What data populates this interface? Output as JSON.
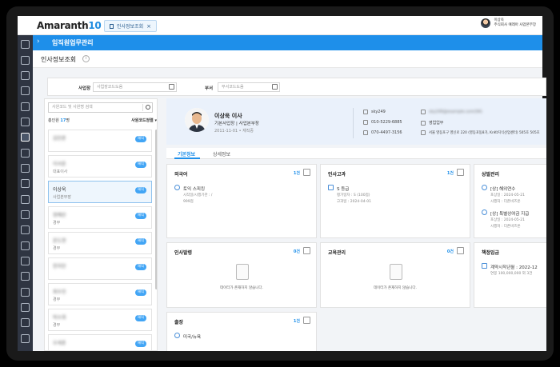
{
  "app": {
    "logo_main": "Amaranth",
    "logo_num": "10"
  },
  "open_tab": {
    "label": "인사정보조회",
    "close": "×"
  },
  "user": {
    "name": "이상욱",
    "org": "주식회사 예레아 사업본부장"
  },
  "menu": {
    "title": "임직원업무관리",
    "chevron": "›"
  },
  "page": {
    "title": "인사정보조회",
    "info": "i"
  },
  "filters": {
    "site_label": "사업장",
    "site_placeholder": "사업장코드도움",
    "dept_label": "부서",
    "dept_placeholder": "부서코드도움"
  },
  "employee_list": {
    "search_placeholder": "사원코드 및 사원명 검색",
    "count_prefix": "총인원 ",
    "count": "17",
    "count_suffix": "명",
    "sort_label": "사원코드정렬 ▾",
    "items": [
      {
        "name": "김민준",
        "role": "",
        "badge": "재직",
        "blur": true
      },
      {
        "name": "이서윤",
        "role": "대표이사",
        "badge": "재직",
        "blur": true
      },
      {
        "name": "이상욱",
        "role": "사업본부장",
        "badge": "재직",
        "blur": false
      },
      {
        "name": "정예린",
        "role": "경부",
        "badge": "재직",
        "blur": true
      },
      {
        "name": "윤도현",
        "role": "경부",
        "badge": "재직",
        "blur": true
      },
      {
        "name": "한지민",
        "role": "",
        "badge": "재직",
        "blur": true
      },
      {
        "name": "최우진",
        "role": "경부",
        "badge": "재직",
        "blur": true
      },
      {
        "name": "박소희",
        "role": "경부",
        "badge": "재직",
        "blur": true
      },
      {
        "name": "오세훈",
        "role": "",
        "badge": "재직",
        "blur": true
      }
    ]
  },
  "profile": {
    "name": "이상욱 이사",
    "dept": "기본사업장 | 사업본부장",
    "date": "2011-11-01 • 재직중",
    "id": "sky249",
    "phone": "010-5229-6885",
    "tel": "070-4497-3156",
    "email": "sky249@example.com(94)",
    "job": "영업업무",
    "address": "서울 영등포구 영신로 220 (영등포동8가, KnKt지식산업센터) 505호 505호"
  },
  "tabs": {
    "basic": "기본정보",
    "detail": "상세정보"
  },
  "cards": {
    "lang": {
      "title": "외국어",
      "count": "1건",
      "item": "토익 스피킹",
      "sub1": "시작일/시행기관 : /",
      "sub2": "999점"
    },
    "cert": {
      "title": "인사고과",
      "count": "1건",
      "item": "S 등급",
      "sub1": "평가일자 : S (100점)",
      "sub2": "고과일 : 2024-04-01"
    },
    "award": {
      "title": "상벌관리",
      "item1": "[상] 해외연수",
      "sub1a": "포상일 : 2024-05-21",
      "sub1b": "시행처 : 더존비즈온",
      "item2": "[상] 특별상여금 지급",
      "sub2a": "포상일 : 2024-05-21",
      "sub2b": "시행처 : 더존비즈온"
    },
    "appoint": {
      "title": "인사발령",
      "count": "0건",
      "empty": "데이터가 존재하지 않습니다."
    },
    "edu": {
      "title": "교육관리",
      "count": "0건",
      "empty": "데이터가 존재하지 않습니다."
    },
    "salary": {
      "title": "책정임금",
      "item": "계약시작년월 : 2022-12",
      "sub": "연봉 100,000,000 외 3건"
    },
    "trip": {
      "title": "출장",
      "count": "1건",
      "item": "미국/뉴욕"
    }
  }
}
